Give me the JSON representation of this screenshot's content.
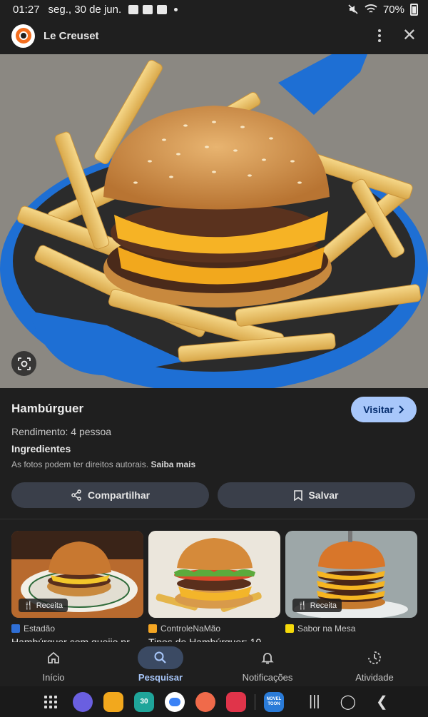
{
  "status_bar": {
    "time": "01:27",
    "date": "seg., 30 de jun.",
    "battery": "70%"
  },
  "header": {
    "site_name": "Le Creuset"
  },
  "recipe": {
    "title": "Hambúrguer",
    "visit_label": "Visitar",
    "yield": "Rendimento: 4 pessoa",
    "ingredients_label": "Ingredientes",
    "copyright_notice": "As fotos podem ter direitos autorais.",
    "learn_more": "Saiba mais",
    "share_label": "Compartilhar",
    "save_label": "Salvar"
  },
  "related": [
    {
      "badge": "Receita",
      "source": "Estadão",
      "title": "Hambúrguer com queijo pr",
      "favicon_color": "#2f6fd6"
    },
    {
      "badge": "",
      "source": "ControleNaMão",
      "title": "Tipos de Hambúrguer: 10",
      "favicon_color": "#f5a623"
    },
    {
      "badge": "Receita",
      "source": "Sabor na Mesa",
      "title": "",
      "favicon_color": "#f5d90a"
    }
  ],
  "bottom_nav": [
    {
      "label": "Início",
      "icon": "home-icon"
    },
    {
      "label": "Pesquisar",
      "icon": "search-icon",
      "active": true
    },
    {
      "label": "Notificações",
      "icon": "bell-icon"
    },
    {
      "label": "Atividade",
      "icon": "activity-icon"
    }
  ],
  "dock": {
    "calendar_day": "30",
    "novel_app": "NOVEL TOON"
  },
  "colors": {
    "background": "#1f1f1f",
    "accent": "#a8c7fa",
    "pan_blue": "#1e6fd4"
  }
}
